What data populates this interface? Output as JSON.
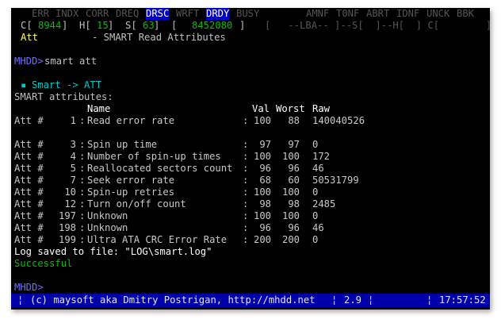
{
  "flags_row": {
    "err": "ERR",
    "indx": "INDX",
    "corr": "CORR",
    "dreq": "DREQ",
    "drsc": "DRSC",
    "wrft": "WRFT",
    "drdy": "DRDY",
    "busy": "BUSY",
    "amnf": "AMNF",
    "t0nf": "T0NF",
    "abrt": "ABRT",
    "idnf": "IDNF",
    "unck": "UNCK",
    "bbk": "BBK"
  },
  "geometry_row": {
    "c_label": "C[",
    "c_value": "8944",
    "h_label": "]  H[",
    "h_value": "15",
    "s_label": "]  S[",
    "s_value": "63",
    "lba_label": "]  [",
    "lba_value": "8452080",
    "lba_close": "]",
    "right_part": "[   --LBA-- ]--S[  ]--H[  ] C[        ]"
  },
  "mode_row": {
    "mode": "Att",
    "title": "- SMART Read Attributes"
  },
  "prompt1": {
    "prompt": "MHDD>",
    "command": "smart att"
  },
  "smart_header": {
    "bullet": "▪",
    "label": "Smart -> ATT"
  },
  "attr_title": "SMART attributes:",
  "col_headers": {
    "name": "Name",
    "val": "Val",
    "worst": "Worst",
    "raw": "Raw"
  },
  "attributes": [
    {
      "prefix": "Att #",
      "id": "1",
      "name": "Read error rate",
      "val": "100",
      "worst": "88",
      "raw": "140040526"
    },
    {
      "prefix": "Att #",
      "id": "3",
      "name": "Spin up time",
      "val": "97",
      "worst": "97",
      "raw": "0"
    },
    {
      "prefix": "Att #",
      "id": "4",
      "name": "Number of spin-up times",
      "val": "100",
      "worst": "100",
      "raw": "172"
    },
    {
      "prefix": "Att #",
      "id": "5",
      "name": "Reallocated sectors count",
      "val": "96",
      "worst": "96",
      "raw": "46"
    },
    {
      "prefix": "Att #",
      "id": "7",
      "name": "Seek error rate",
      "val": "68",
      "worst": "60",
      "raw": "50531799"
    },
    {
      "prefix": "Att #",
      "id": "10",
      "name": "Spin-up retries",
      "val": "100",
      "worst": "100",
      "raw": "0"
    },
    {
      "prefix": "Att #",
      "id": "12",
      "name": "Turn on/off count",
      "val": "98",
      "worst": "98",
      "raw": "2485"
    },
    {
      "prefix": "Att #",
      "id": "197",
      "name": "Unknown",
      "val": "100",
      "worst": "100",
      "raw": "0"
    },
    {
      "prefix": "Att #",
      "id": "198",
      "name": "Unknown",
      "val": "96",
      "worst": "96",
      "raw": "46"
    },
    {
      "prefix": "Att #",
      "id": "199",
      "name": "Ultra ATA CRC Error Rate",
      "val": "200",
      "worst": "200",
      "raw": "0"
    }
  ],
  "separators": {
    "colon": ":"
  },
  "log_line": "Log saved to file: \"LOG\\smart.log\"",
  "result": "Successful",
  "prompt2": {
    "prompt": "MHDD>"
  },
  "status_bar": {
    "left_bar": "¦",
    "credits": "(c) maysoft aka Dmitry Postrigan, http://mhdd.net",
    "sep1": "¦",
    "version": "2.9",
    "sep2": "¦",
    "sep3": "¦",
    "time": "17:57:52"
  },
  "colors": {
    "terminal_bg": "#000000",
    "text": "#c8c8c8",
    "green": "#00c000",
    "yellow": "#ffff55",
    "cyan": "#00c8c8",
    "flag_highlight": "#0000c8",
    "status_bg": "#0000aa"
  }
}
